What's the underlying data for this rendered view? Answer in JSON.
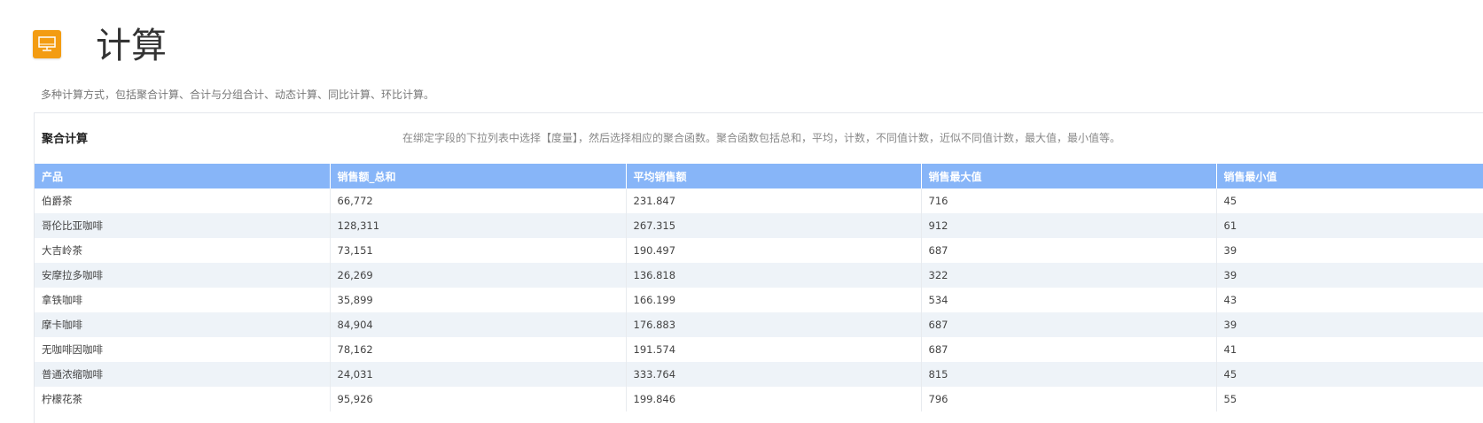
{
  "header": {
    "title": "计算",
    "icon": "monitor-icon",
    "icon_color": "#f39c12"
  },
  "description": "多种计算方式，包括聚合计算、合计与分组合计、动态计算、同比计算、环比计算。",
  "panel": {
    "title": "聚合计算",
    "note": "在绑定字段的下拉列表中选择【度量】，然后选择相应的聚合函数。聚合函数包括总和，平均，计数，不同值计数，近似不同值计数，最大值，最小值等。"
  },
  "table": {
    "header_color": "#87b5f8",
    "stripe_color": "#eef3f8",
    "columns": [
      "产品",
      "销售额_总和",
      "平均销售额",
      "销售最大值",
      "销售最小值"
    ],
    "rows": [
      [
        "伯爵茶",
        "66,772",
        "231.847",
        "716",
        "45"
      ],
      [
        "哥伦比亚咖啡",
        "128,311",
        "267.315",
        "912",
        "61"
      ],
      [
        "大吉岭茶",
        "73,151",
        "190.497",
        "687",
        "39"
      ],
      [
        "安摩拉多咖啡",
        "26,269",
        "136.818",
        "322",
        "39"
      ],
      [
        "拿铁咖啡",
        "35,899",
        "166.199",
        "534",
        "43"
      ],
      [
        "摩卡咖啡",
        "84,904",
        "176.883",
        "687",
        "39"
      ],
      [
        "无咖啡因咖啡",
        "78,162",
        "191.574",
        "687",
        "41"
      ],
      [
        "普通浓缩咖啡",
        "24,031",
        "333.764",
        "815",
        "45"
      ],
      [
        "柠檬花茶",
        "95,926",
        "199.846",
        "796",
        "55"
      ]
    ]
  }
}
